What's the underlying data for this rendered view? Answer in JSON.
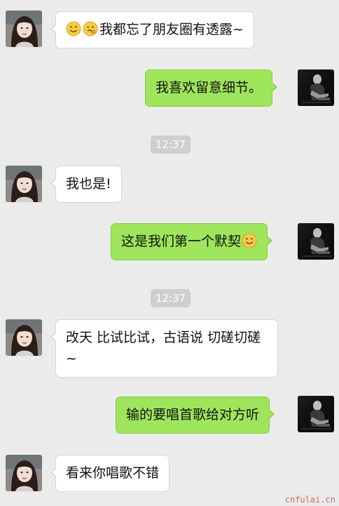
{
  "messages": [
    {
      "side": "left",
      "text": "我都忘了朋友圈有透露~",
      "emojis": [
        "smile-emoji",
        "thinking-emoji"
      ]
    },
    {
      "side": "right",
      "text": "我喜欢留意细节。"
    },
    {
      "timestamp": "12:37"
    },
    {
      "side": "left",
      "text": "我也是!"
    },
    {
      "side": "right",
      "text": "这是我们第一个默契",
      "emojis_after": [
        "smile-emoji"
      ]
    },
    {
      "timestamp": "12:37"
    },
    {
      "side": "left",
      "text": "改天 比试比试，古语说 切磋切磋~"
    },
    {
      "side": "right",
      "text": "输的要唱首歌给对方听"
    },
    {
      "side": "left",
      "text": "看来你唱歌不错"
    }
  ],
  "watermark": "cnfulai.cn",
  "colors": {
    "background": "#ebebeb",
    "sent_bubble": "#9ee55b",
    "received_bubble": "#ffffff",
    "timestamp_badge": "#cfcfcf"
  },
  "avatars": {
    "left": "avatar-woman",
    "right": "avatar-man-bw"
  }
}
